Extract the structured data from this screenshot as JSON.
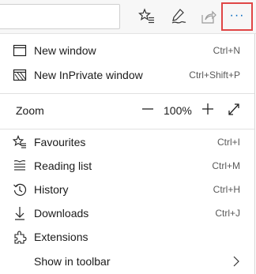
{
  "toolbar": {
    "icons": [
      "favorites-star-icon",
      "pen-icon",
      "share-icon",
      "more-dots-icon"
    ],
    "more_label": "···",
    "highlight_color": "#e04646",
    "accent_color": "#0067c0"
  },
  "menu": {
    "new_window": {
      "label": "New window",
      "shortcut": "Ctrl+N",
      "icon": "window-icon"
    },
    "new_inprivate": {
      "label": "New InPrivate window",
      "shortcut": "Ctrl+Shift+P",
      "icon": "inprivate-icon"
    },
    "zoom": {
      "label": "Zoom",
      "value": "100%",
      "minus": "minus-icon",
      "plus": "plus-icon",
      "fullscreen": "fullscreen-icon"
    },
    "favourites": {
      "label": "Favourites",
      "shortcut": "Ctrl+I",
      "icon": "star-list-icon"
    },
    "reading_list": {
      "label": "Reading list",
      "shortcut": "Ctrl+M",
      "icon": "reading-list-icon"
    },
    "history": {
      "label": "History",
      "shortcut": "Ctrl+H",
      "icon": "history-icon"
    },
    "downloads": {
      "label": "Downloads",
      "shortcut": "Ctrl+J",
      "icon": "download-icon"
    },
    "extensions": {
      "label": "Extensions",
      "icon": "extensions-icon"
    },
    "show_in_toolbar": {
      "label": "Show in toolbar",
      "icon": "chevron-right-icon"
    }
  }
}
